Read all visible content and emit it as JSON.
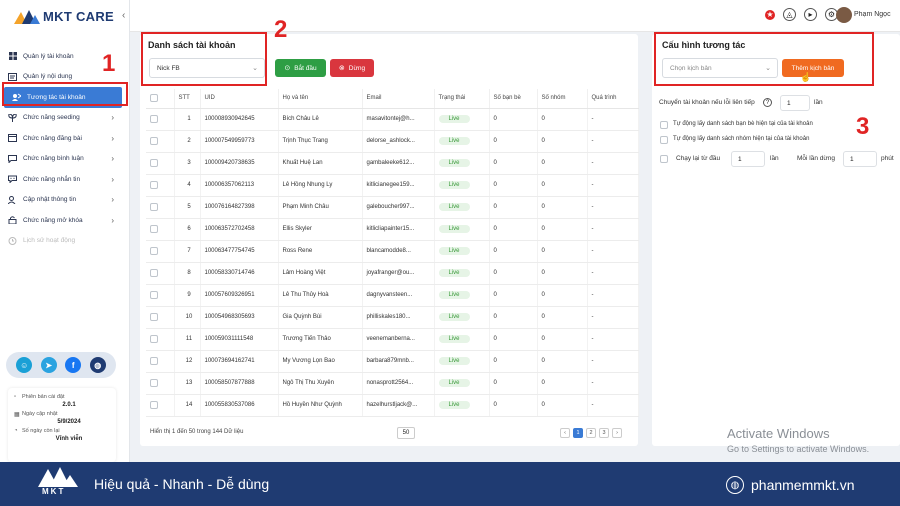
{
  "brand": {
    "name": "MKT CARE"
  },
  "sidebar": {
    "items": [
      {
        "label": "Quản lý tài khoản",
        "icon": "grid-icon"
      },
      {
        "label": "Quản lý nội dung",
        "icon": "content-icon"
      },
      {
        "label": "Tương tác tài khoản",
        "icon": "interaction-icon",
        "active": true
      },
      {
        "label": "Chức năng seeding",
        "icon": "seeding-icon"
      },
      {
        "label": "Chức năng đăng bài",
        "icon": "post-icon"
      },
      {
        "label": "Chức năng bình luận",
        "icon": "comment-icon"
      },
      {
        "label": "Chức năng nhắn tin",
        "icon": "message-icon"
      },
      {
        "label": "Cập nhật thông tin",
        "icon": "update-icon"
      },
      {
        "label": "Chức năng mở khóa",
        "icon": "unlock-icon"
      },
      {
        "label": "Lịch sử hoạt động",
        "icon": "history-icon"
      }
    ]
  },
  "info": {
    "version_label": "Phiên bản cài đặt",
    "version": "2.0.1",
    "update_label": "Ngày cập nhật",
    "update_date": "5/9/2024",
    "days_label": "Số ngày còn lại",
    "days_value": "Vĩnh viễn"
  },
  "topbar": {
    "username": "Phạm Ngọc"
  },
  "accounts": {
    "title": "Danh sách tài khoản",
    "group_select": "Nick FB",
    "start_label": "Bắt đầu",
    "stop_label": "Dừng",
    "columns": [
      "",
      "STT",
      "UID",
      "Họ và tên",
      "Email",
      "Trạng thái",
      "Số bạn bè",
      "Số nhóm",
      "Quá trình"
    ],
    "rows": [
      [
        "1",
        "100008930942645",
        "Bích Châu Lê",
        "masavitontej@h...",
        "Live",
        "0",
        "0",
        "-"
      ],
      [
        "2",
        "100007549959773",
        "Trịnh Thục Trang",
        "delorse_ashlock...",
        "Live",
        "0",
        "0",
        "-"
      ],
      [
        "3",
        "100009420738635",
        "Khuất Huệ Lan",
        "gambaleeke612...",
        "Live",
        "0",
        "0",
        "-"
      ],
      [
        "4",
        "100006357062113",
        "Lê Hồng Nhung Ly",
        "kitlicianegee159...",
        "Live",
        "0",
        "0",
        "-"
      ],
      [
        "5",
        "100076164827398",
        "Phạm Minh Châu",
        "galeboucher997...",
        "Live",
        "0",
        "0",
        "-"
      ],
      [
        "6",
        "100063572702458",
        "Ellis Skyler",
        "kitlicliapainter15...",
        "Live",
        "0",
        "0",
        "-"
      ],
      [
        "7",
        "100063477754745",
        "Ross Rene",
        "blancamodde8...",
        "Live",
        "0",
        "0",
        "-"
      ],
      [
        "8",
        "100058330714746",
        "Lâm Hoàng Việt",
        "joyafranger@ou...",
        "Live",
        "0",
        "0",
        "-"
      ],
      [
        "9",
        "100057609326951",
        "Lê Thu Thủy Hoà",
        "dagnyvansteen...",
        "Live",
        "0",
        "0",
        "-"
      ],
      [
        "10",
        "100054968305693",
        "Gia Quỳnh Bùi",
        "philliskales180...",
        "Live",
        "0",
        "0",
        "-"
      ],
      [
        "11",
        "100059031111548",
        "Trương Tiến Thảo",
        "veenemanberna...",
        "Live",
        "0",
        "0",
        "-"
      ],
      [
        "12",
        "100073694162741",
        "My Vương Lọn Bao",
        "barbara879mnb...",
        "Live",
        "0",
        "0",
        "-"
      ],
      [
        "13",
        "100058507877888",
        "Ngô Thị Thu Xuyên",
        "nonasprott2564...",
        "Live",
        "0",
        "0",
        "-"
      ],
      [
        "14",
        "100055830537086",
        "Hồ Huyền Như Quỳnh",
        "hazelhurstljack@...",
        "Live",
        "0",
        "0",
        "-"
      ]
    ],
    "footer_text": "Hiển thị 1 đến 50 trong 144 Dữ liệu",
    "page_size": "50",
    "pages": [
      "‹",
      "1",
      "2",
      "3",
      "›"
    ]
  },
  "config": {
    "title": "Cấu hình tương tác",
    "script_placeholder": "Chọn kịch bản",
    "add_script_label": "Thêm kịch bản",
    "switch_label": "Chuyển tài khoản nếu lỗi liên tiếp",
    "switch_value": "1",
    "switch_unit": "lần",
    "opt1": "Tự động lấy danh sách bạn bè hiện tại của tài khoản",
    "opt2": "Tự động lấy danh sách nhóm hiện tại của tài khoản",
    "repeat_label": "Chạy lại từ đầu",
    "repeat_value": "1",
    "repeat_unit": "lần",
    "each_label": "Mỗi lần dừng",
    "each_value": "1",
    "each_unit": "phút"
  },
  "annotations": {
    "n1": "1",
    "n2": "2",
    "n3": "3"
  },
  "banner": {
    "slogan": "Hiệu quả - Nhanh - Dễ dùng",
    "website": "phanmemmkt.vn",
    "logo_text": "MKT"
  },
  "watermark": {
    "line1": "Activate Windows",
    "line2": "Go to Settings to activate Windows."
  },
  "colors": {
    "accent": "#3a7bd5",
    "start": "#2e9e44",
    "stop": "#d9363e",
    "add": "#f06a20",
    "annotation": "#e02424",
    "banner": "#1f3b72"
  }
}
